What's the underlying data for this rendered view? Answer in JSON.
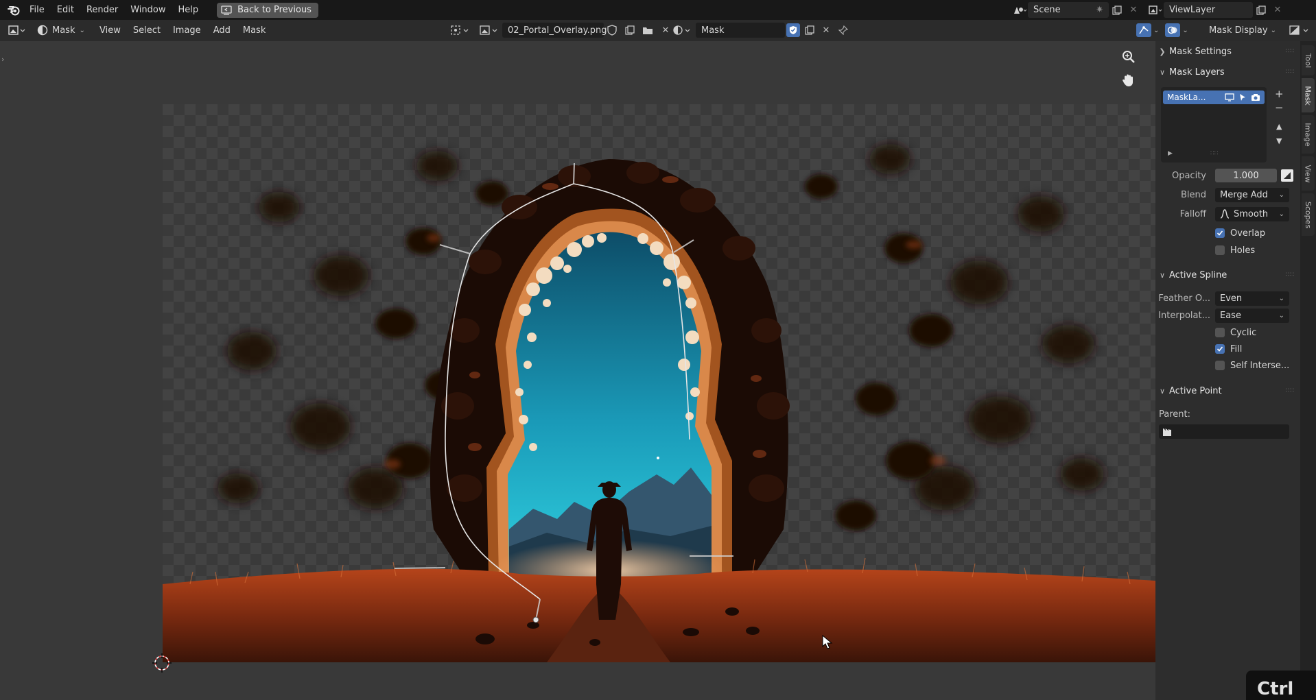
{
  "menubar": {
    "items": [
      "File",
      "Edit",
      "Render",
      "Window",
      "Help"
    ],
    "back_button": "Back to Previous",
    "scene": "Scene",
    "view_layer": "ViewLayer"
  },
  "header": {
    "mode": "Mask",
    "menus": [
      "View",
      "Select",
      "Image",
      "Add",
      "Mask"
    ],
    "image_name": "02_Portal_Overlay.png",
    "mask_name": "Mask",
    "mask_display": "Mask Display"
  },
  "panel": {
    "mask_settings": "Mask Settings",
    "mask_layers": "Mask Layers",
    "layer_name": "MaskLa...",
    "opacity_label": "Opacity",
    "opacity_value": "1.000",
    "blend_label": "Blend",
    "blend_value": "Merge Add",
    "falloff_label": "Falloff",
    "falloff_value": "Smooth",
    "overlap": "Overlap",
    "holes": "Holes",
    "active_spline": "Active Spline",
    "feather_label": "Feather O...",
    "feather_value": "Even",
    "interp_label": "Interpolat...",
    "interp_value": "Ease",
    "cyclic": "Cyclic",
    "fill": "Fill",
    "self_intersect": "Self Interse...",
    "active_point": "Active Point",
    "parent_label": "Parent:"
  },
  "checkboxes": {
    "overlap": true,
    "holes": false,
    "cyclic": false,
    "fill": true,
    "self_intersect": false
  },
  "tabs": [
    "Tool",
    "Mask",
    "Image",
    "View",
    "Scopes"
  ],
  "active_tab": "Mask",
  "key_overlay": "Ctrl",
  "colors": {
    "accent": "#4772b3",
    "panel": "#2d2d2d",
    "viewport": "#393939"
  }
}
